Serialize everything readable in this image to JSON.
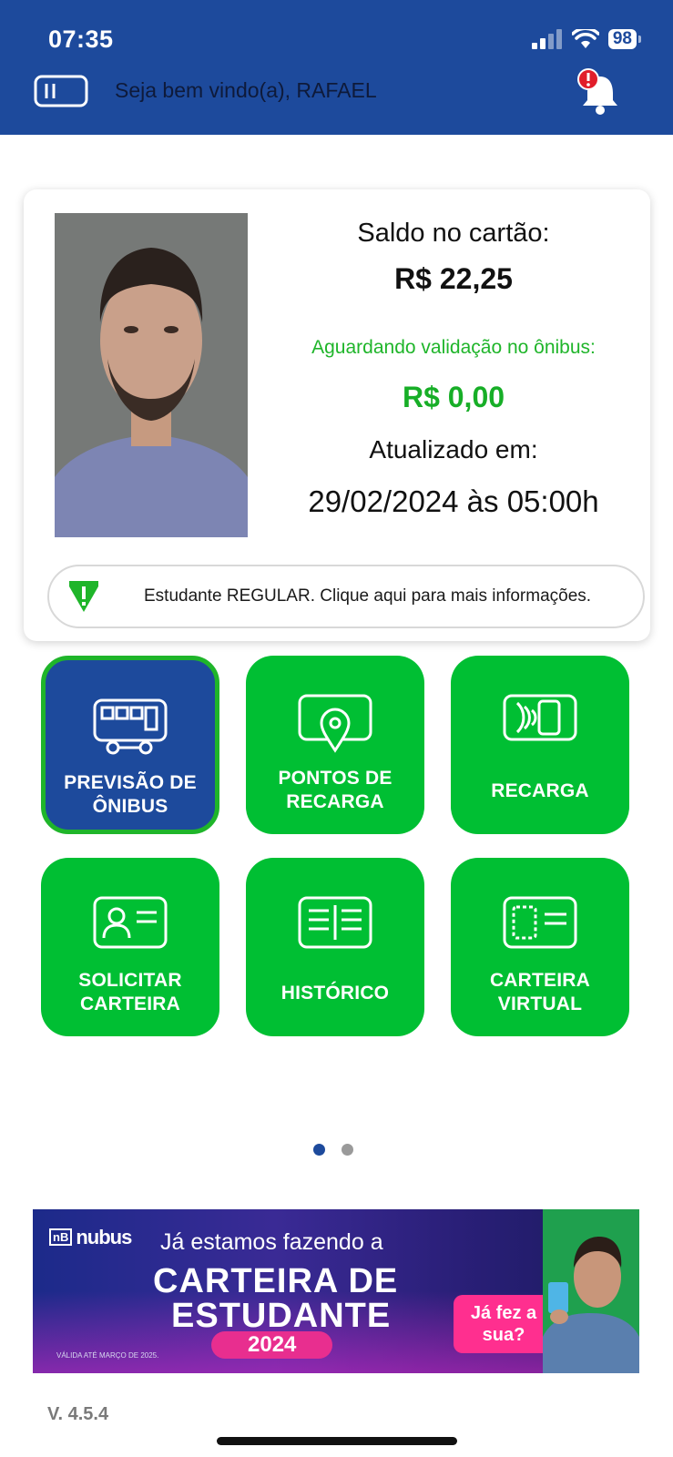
{
  "status_bar": {
    "time": "07:35",
    "battery": "98"
  },
  "header": {
    "welcome": "Seja bem vindo(a), RAFAEL"
  },
  "balance": {
    "saldo_label": "Saldo no cartão:",
    "saldo_value": "R$ 22,25",
    "aguardando_label": "Aguardando validação no ônibus:",
    "aguardando_value": "R$ 0,00",
    "atualizado_label": "Atualizado em:",
    "atualizado_value": "29/02/2024 às 05:00h",
    "status_text": "Estudante REGULAR. Clique aqui para mais informações."
  },
  "menu": [
    {
      "label": "PREVISÃO DE ÔNIBUS",
      "icon": "bus-icon"
    },
    {
      "label": "PONTOS DE RECARGA",
      "icon": "map-pin-icon"
    },
    {
      "label": "RECARGA",
      "icon": "contactless-card-icon"
    },
    {
      "label": "SOLICITAR CARTEIRA",
      "icon": "id-card-icon"
    },
    {
      "label": "HISTÓRICO",
      "icon": "history-icon"
    },
    {
      "label": "CARTEIRA VIRTUAL",
      "icon": "virtual-card-icon"
    }
  ],
  "banner": {
    "logo": "nubus",
    "line1": "Já estamos fazendo a",
    "line2": "CARTEIRA DE",
    "line3": "ESTUDANTE",
    "year": "2024",
    "cta": "Já fez a sua?",
    "note": "VÁLIDA ATÉ MARÇO DE 2025."
  },
  "version": "V. 4.5.4",
  "colors": {
    "header_blue": "#1d4a9c",
    "tile_green": "#00bf33",
    "accent_green": "#1fb52a"
  }
}
